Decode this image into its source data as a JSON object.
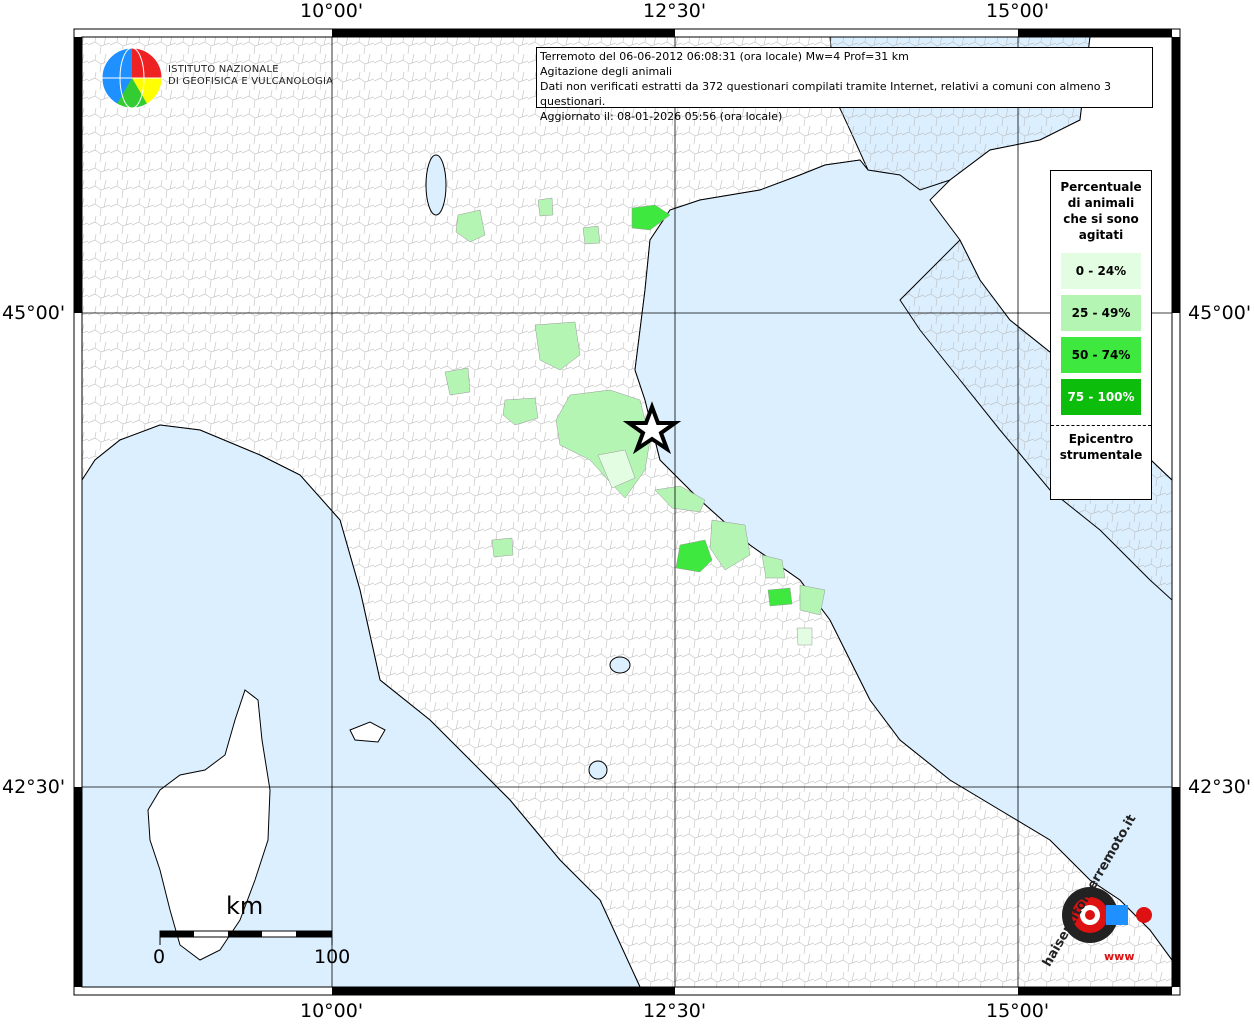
{
  "map": {
    "top_labels": [
      "10°00'",
      "12°30'",
      "15°00'"
    ],
    "bottom_labels": [
      "10°00'",
      "12°30'",
      "15°00'"
    ],
    "left_labels": [
      "45°00'",
      "42°30'"
    ],
    "right_labels": [
      "45°00'",
      "42°30'"
    ],
    "colors": {
      "sea": "#dcefff",
      "land": "#ffffff",
      "class_0_24": "#e2fde2",
      "class_25_49": "#b4f5b4",
      "class_50_74": "#3ee83e",
      "class_75_100": "#0cbd0c"
    }
  },
  "info": {
    "line1": "Terremoto del 06-06-2012 06:08:31 (ora locale) Mw=4 Prof=31 km",
    "line2": "Agitazione degli animali",
    "line3": "Dati non verificati estratti da 372 questionari compilati tramite Internet, relativi a comuni con almeno 3 questionari.",
    "line4": "Aggiornato il: 08-01-2026 05:56 (ora locale)"
  },
  "logo": {
    "line1": "ISTITUTO NAZIONALE",
    "line2": "DI GEOFISICA E VULCANOLOGIA"
  },
  "legend": {
    "title_lines": [
      "Percentuale",
      "di animali",
      "che si sono",
      "agitati"
    ],
    "items": [
      "0 - 24%",
      "25 - 49%",
      "50 - 74%",
      "75 - 100%"
    ],
    "epicenter_lines": [
      "Epicentro",
      "strumentale"
    ]
  },
  "scale": {
    "unit": "km",
    "min": "0",
    "max": "100"
  },
  "watermark": {
    "text": "haisentitoilterremoto.it",
    "sub": "www"
  }
}
